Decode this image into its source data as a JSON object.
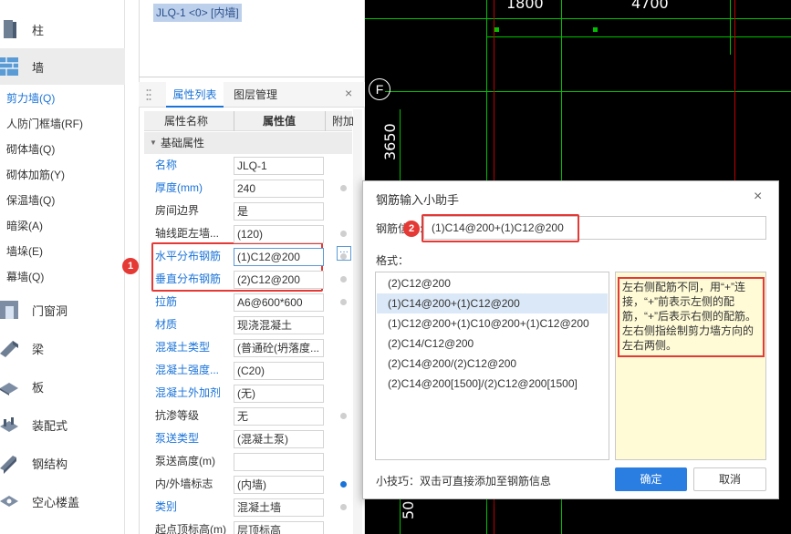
{
  "left_nav": {
    "categories": [
      {
        "label": "柱",
        "icon": "column-icon"
      },
      {
        "label": "墙",
        "icon": "wall-icon"
      },
      {
        "label": "门窗洞",
        "icon": "door-window-icon"
      },
      {
        "label": "梁",
        "icon": "beam-icon"
      },
      {
        "label": "板",
        "icon": "slab-icon"
      },
      {
        "label": "装配式",
        "icon": "prefab-icon"
      },
      {
        "label": "钢结构",
        "icon": "steel-icon"
      },
      {
        "label": "空心楼盖",
        "icon": "hollow-floor-icon"
      }
    ],
    "wall_items": [
      "剪力墙(Q)",
      "人防门框墙(RF)",
      "砌体墙(Q)",
      "砌体加筋(Y)",
      "保温墙(Q)",
      "暗梁(A)",
      "墙垛(E)",
      "幕墙(Q)"
    ]
  },
  "element_tag": "JLQ-1 <0> [内墙]",
  "panel": {
    "tab_properties": "属性列表",
    "tab_layers": "图层管理",
    "close": "×",
    "col_name": "属性名称",
    "col_value": "属性值",
    "col_add": "附加",
    "group": "基础属性",
    "rows": [
      {
        "name": "名称",
        "value": "JLQ-1",
        "blue": true
      },
      {
        "name": "厚度(mm)",
        "value": "240",
        "blue": true
      },
      {
        "name": "房间边界",
        "value": "是",
        "blue": false
      },
      {
        "name": "轴线距左墙...",
        "value": "(120)",
        "blue": false
      },
      {
        "name": "水平分布钢筋",
        "value": "(1)C12@200",
        "blue": true
      },
      {
        "name": "垂直分布钢筋",
        "value": "(2)C12@200",
        "blue": true
      },
      {
        "name": "拉筋",
        "value": "A6@600*600",
        "blue": true
      },
      {
        "name": "材质",
        "value": "现浇混凝土",
        "blue": true
      },
      {
        "name": "混凝土类型",
        "value": "(普通砼(坍落度...",
        "blue": true
      },
      {
        "name": "混凝土强度...",
        "value": "(C20)",
        "blue": true
      },
      {
        "name": "混凝土外加剂",
        "value": "(无)",
        "blue": true
      },
      {
        "name": "抗渗等级",
        "value": "无",
        "blue": false
      },
      {
        "name": "泵送类型",
        "value": "(混凝土泵)",
        "blue": true
      },
      {
        "name": "泵送高度(m)",
        "value": "",
        "blue": false
      },
      {
        "name": "内/外墙标志",
        "value": "(内墙)",
        "blue": false
      },
      {
        "name": "类别",
        "value": "混凝土墙",
        "blue": true
      },
      {
        "name": "起点顶标高(m)",
        "value": "层顶标高",
        "blue": false
      }
    ]
  },
  "annotations": {
    "badge1": "1",
    "badge2": "2"
  },
  "cad": {
    "dim_1800": "1800",
    "dim_4700": "4700",
    "axis_f": "F",
    "dim_3650": "3650",
    "dim_50": "50"
  },
  "dialog": {
    "title": "钢筋输入小助手",
    "close": "×",
    "info_label": "钢筋信息:",
    "info_value": "(1)C14@200+(1)C12@200",
    "format_label": "格式：",
    "formats": [
      "(2)C12@200",
      "(1)C14@200+(1)C12@200",
      "(1)C12@200+(1)C10@200+(1)C12@200",
      "(2)C14/C12@200",
      "(2)C14@200/(2)C12@200",
      "(2)C14@200[1500]/(2)C12@200[1500]"
    ],
    "selected_index": 1,
    "hint": "左右侧配筋不同，用“+”连接，“+”前表示左侧的配筋，“+”后表示右侧的配筋。左右侧指绘制剪力墙方向的左右两侧。",
    "tip": "小技巧：双击可直接添加至钢筋信息",
    "ok": "确定",
    "cancel": "取消"
  },
  "colors": {
    "accent": "#1a73d8",
    "annotation_red": "#e53935",
    "cad_green": "#00c000",
    "cad_bg": "#000000",
    "hint_bg": "#fffbd6"
  }
}
